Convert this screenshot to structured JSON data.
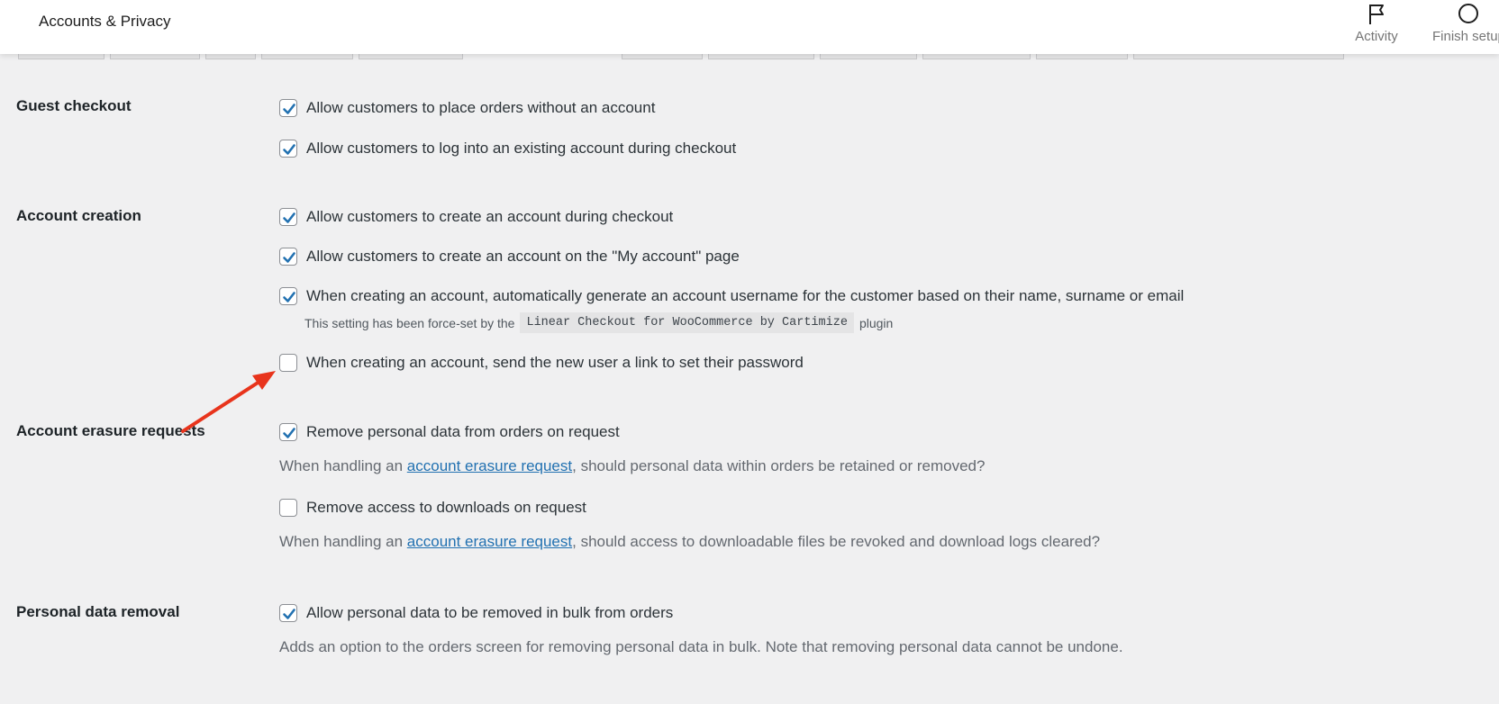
{
  "header": {
    "title": "Accounts & Privacy",
    "actions": [
      {
        "label": "Activity",
        "icon": "flag-icon"
      },
      {
        "label": "Finish setup",
        "icon": "circle-icon"
      }
    ]
  },
  "colors": {
    "checkbox_check": "#2271b1",
    "link": "#2271b1",
    "annotation_arrow": "#e8341c"
  },
  "guest_checkout": {
    "label": "Guest checkout",
    "options": [
      {
        "label": "Allow customers to place orders without an account",
        "checked": true
      },
      {
        "label": "Allow customers to log into an existing account during checkout",
        "checked": true
      }
    ]
  },
  "account_creation": {
    "label": "Account creation",
    "options": [
      {
        "label": "Allow customers to create an account during checkout",
        "checked": true
      },
      {
        "label": "Allow customers to create an account on the \"My account\" page",
        "checked": true
      },
      {
        "label": "When creating an account, automatically generate an account username for the customer based on their name, surname or email",
        "checked": true
      },
      {
        "label": "When creating an account, send the new user a link to set their password",
        "checked": false
      }
    ],
    "forced_note": {
      "prefix": "This setting has been force-set by the",
      "plugin": "Linear Checkout for WooCommerce by Cartimize",
      "suffix": "plugin"
    }
  },
  "account_erasure": {
    "label": "Account erasure requests",
    "options": [
      {
        "label": "Remove personal data from orders on request",
        "checked": true,
        "desc_prefix": "When handling an",
        "desc_link": "account erasure request",
        "desc_suffix": ", should personal data within orders be retained or removed?"
      },
      {
        "label": "Remove access to downloads on request",
        "checked": false,
        "desc_prefix": "When handling an",
        "desc_link": "account erasure request",
        "desc_suffix": ", should access to downloadable files be revoked and download logs cleared?"
      }
    ]
  },
  "personal_data_removal": {
    "label": "Personal data removal",
    "options": [
      {
        "label": "Allow personal data to be removed in bulk from orders",
        "checked": true
      }
    ],
    "description": "Adds an option to the orders screen for removing personal data in bulk. Note that removing personal data cannot be undone."
  }
}
